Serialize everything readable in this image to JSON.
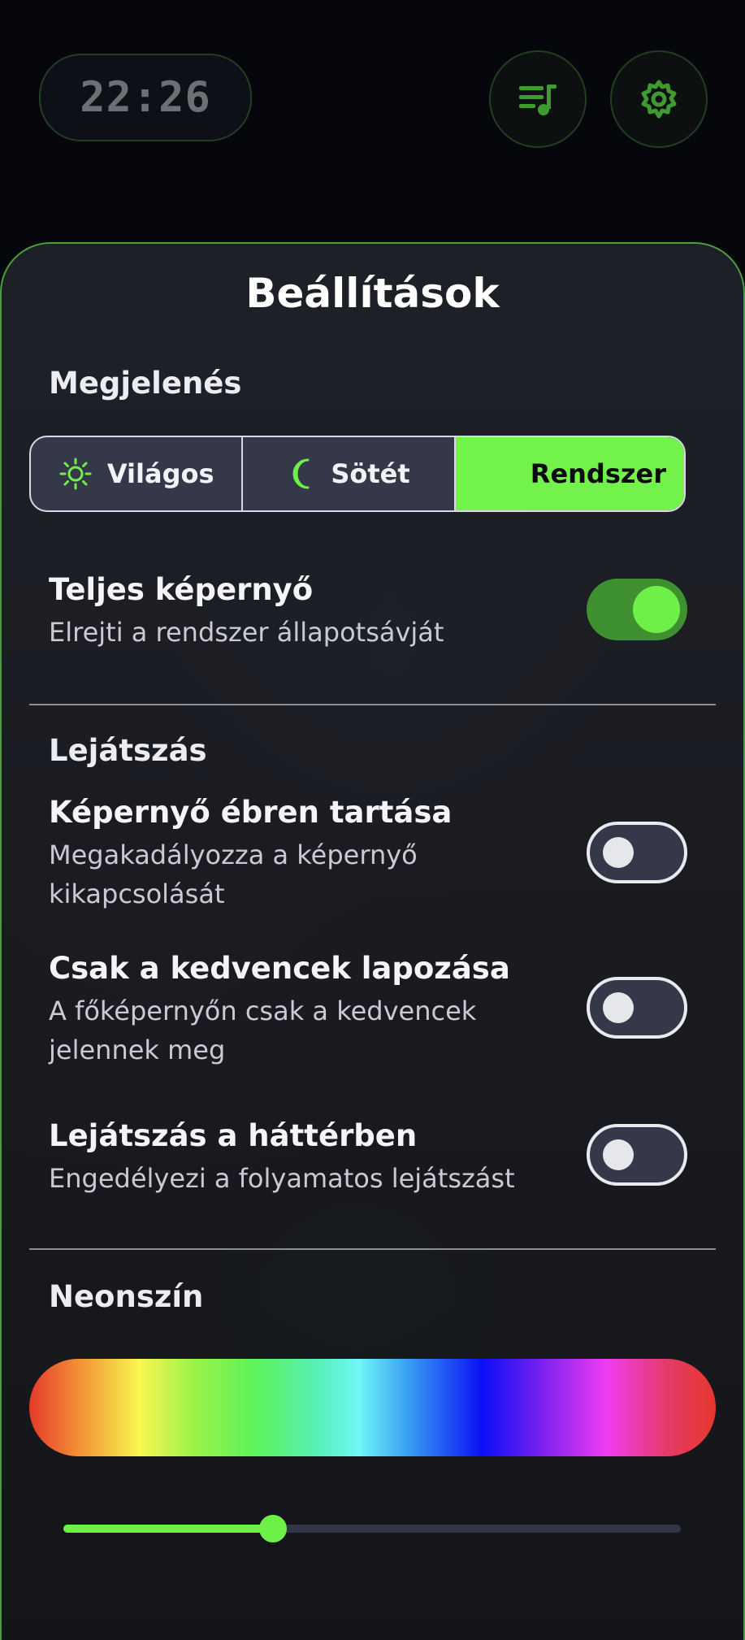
{
  "header": {
    "clock": "22:26",
    "playlist_icon": "playlist-music-icon",
    "settings_icon": "gear-icon"
  },
  "settings": {
    "title": "Beállítások",
    "appearance": {
      "label": "Megjelenés",
      "options": [
        {
          "label": "Világos",
          "icon": "sun-icon"
        },
        {
          "label": "Sötét",
          "icon": "moon-icon"
        },
        {
          "label": "Rendszer",
          "icon": ""
        }
      ],
      "selected": "Rendszer"
    },
    "fullscreen": {
      "title": "Teljes képernyő",
      "description": "Elrejti a rendszer állapotsávját",
      "enabled": true
    },
    "playback": {
      "label": "Lejátszás",
      "keep_awake": {
        "title": "Képernyő ébren tartása",
        "description": "Megakadályozza a képernyő kikapcsolását",
        "enabled": false
      },
      "favorites_only": {
        "title": "Csak a kedvencek lapozása",
        "description": "A főképernyőn csak a kedvencek jelennek meg",
        "enabled": false
      },
      "background": {
        "title": "Lejátszás a háttérben",
        "description": "Engedélyezi a folyamatos lejátszást",
        "enabled": false
      }
    },
    "neon": {
      "label": "Neonszín",
      "slider_fraction": 0.34
    }
  },
  "colors": {
    "accent": "#6ff048",
    "accent_dark": "#3e9030",
    "panel_border": "#4b9f35",
    "background": "#05070d"
  }
}
